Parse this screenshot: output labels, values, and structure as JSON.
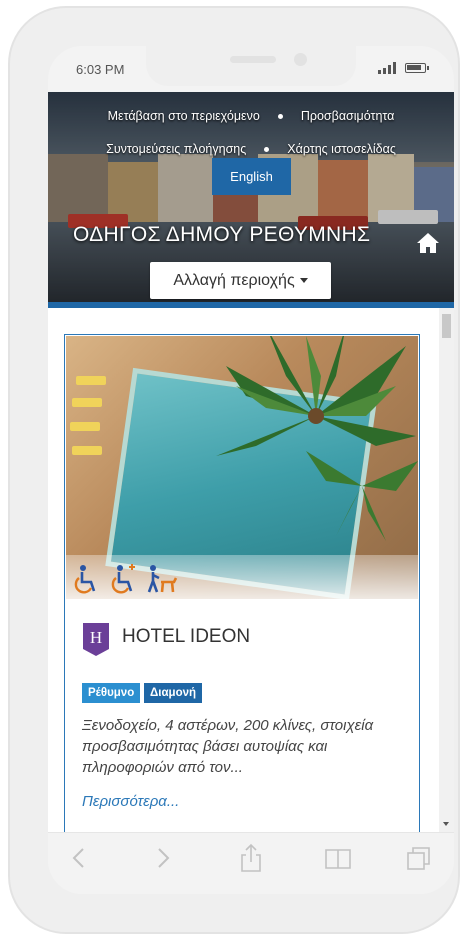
{
  "status_bar": {
    "time": "6:03 PM"
  },
  "header": {
    "skip_links": [
      "Μετάβαση στο περιεχόμενο",
      "Προσβασιμότητα",
      "Συντομεύσεις πλοήγησης",
      "Χάρτης ιστοσελίδας"
    ],
    "language_button": "English",
    "site_title": "ΟΔΗΓΟΣ ΔΗΜΟΥ ΡΕΘΥΜΝΗΣ",
    "change_area_button": "Αλλαγή περιοχής",
    "accent_color": "#1f67a6"
  },
  "card": {
    "logo_letter": "H",
    "title": "HOTEL IDEON",
    "tags": [
      {
        "label": "Ρέθυμνο",
        "color": "#2b8fd0"
      },
      {
        "label": "Διαμονή",
        "color": "#1f67a6"
      }
    ],
    "description": "Ξενοδοχείο, 4 αστέρων, 200 κλίνες, στοιχεία προσβασιμότητας βάσει αυτοψίας και πληροφοριών από τον...",
    "more_link": "Περισσότερα...",
    "accessibility_icons": [
      "wheelchair-icon",
      "wheelchair-assistance-icon",
      "guide-dog-icon"
    ],
    "border_color": "#2b78b8"
  },
  "browser_toolbar": {
    "icons": [
      "back-icon",
      "forward-icon",
      "share-icon",
      "bookmarks-icon",
      "tabs-icon"
    ]
  }
}
